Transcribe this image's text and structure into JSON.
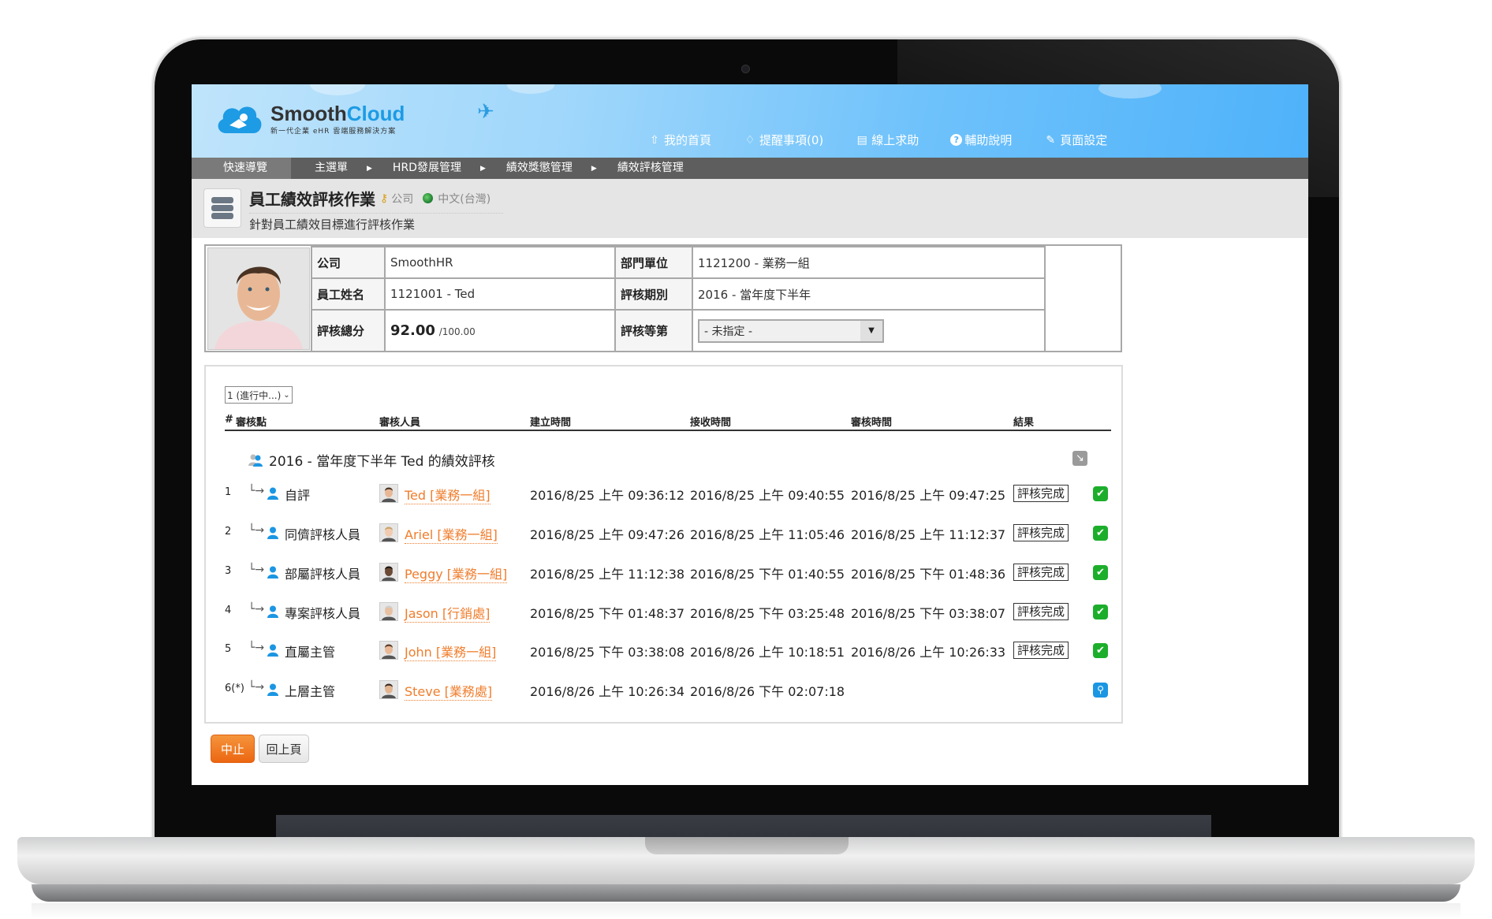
{
  "app": {
    "brand_part1": "Smooth",
    "brand_part2": "Cloud",
    "tagline": "新一代企業 eHR 雲端服務解決方案"
  },
  "top_links": [
    {
      "label": "我的首頁",
      "icon": "home-icon"
    },
    {
      "label": "提醒事項(0)",
      "icon": "bell-icon"
    },
    {
      "label": "線上求助",
      "icon": "help-chat-icon"
    },
    {
      "label": "輔助說明",
      "icon": "question-icon"
    },
    {
      "label": "頁面設定",
      "icon": "settings-icon"
    }
  ],
  "breadcrumb": {
    "quick_nav": "快速導覽",
    "items": [
      "主選單",
      "HRD發展管理",
      "績效獎懲管理",
      "績效評核管理"
    ]
  },
  "page": {
    "title": "員工績效評核作業",
    "scope": "公司",
    "language": "中文(台灣)",
    "subtitle": "針對員工績效目標進行評核作業"
  },
  "employee": {
    "company_label": "公司",
    "company": "SmoothHR",
    "dept_label": "部門單位",
    "dept": "1121200 - 業務一組",
    "name_label": "員工姓名",
    "name": "1121001 - Ted",
    "period_label": "評核期別",
    "period": "2016 - 當年度下半年",
    "score_label": "評核總分",
    "score": "92.00",
    "score_max": "/100.00",
    "grade_label": "評核等第",
    "grade_value": "- 未指定 -"
  },
  "flow": {
    "version_select": "1 (進行中...)",
    "columns": {
      "num": "#",
      "node": "審核點",
      "reviewer": "審核人員",
      "created": "建立時間",
      "received": "接收時間",
      "reviewed": "審核時間",
      "result": "結果"
    },
    "group_title": "2016 - 當年度下半年 Ted 的績效評核",
    "rows": [
      {
        "num": "1",
        "node": "自評",
        "reviewer": "Ted [業務一組]",
        "created": "2016/8/25 上午 09:36:12",
        "received": "2016/8/25 上午 09:40:55",
        "reviewed": "2016/8/25 上午 09:47:25",
        "status": "評核完成",
        "result": "done"
      },
      {
        "num": "2",
        "node": "同儕評核人員",
        "reviewer": "Ariel [業務一組]",
        "created": "2016/8/25 上午 09:47:26",
        "received": "2016/8/25 上午 11:05:46",
        "reviewed": "2016/8/25 上午 11:12:37",
        "status": "評核完成",
        "result": "done"
      },
      {
        "num": "3",
        "node": "部屬評核人員",
        "reviewer": "Peggy [業務一組]",
        "created": "2016/8/25 上午 11:12:38",
        "received": "2016/8/25 下午 01:40:55",
        "reviewed": "2016/8/25 下午 01:48:36",
        "status": "評核完成",
        "result": "done"
      },
      {
        "num": "4",
        "node": "專案評核人員",
        "reviewer": "Jason [行銷處]",
        "created": "2016/8/25 下午 01:48:37",
        "received": "2016/8/25 下午 03:25:48",
        "reviewed": "2016/8/25 下午 03:38:07",
        "status": "評核完成",
        "result": "done"
      },
      {
        "num": "5",
        "node": "直屬主管",
        "reviewer": "John [業務一組]",
        "created": "2016/8/25 下午 03:38:08",
        "received": "2016/8/26 上午 10:18:51",
        "reviewed": "2016/8/26 上午 10:26:33",
        "status": "評核完成",
        "result": "done"
      },
      {
        "num": "6(*)",
        "node": "上層主管",
        "reviewer": "Steve [業務處]",
        "created": "2016/8/26 上午 10:26:34",
        "received": "2016/8/26 下午 02:07:18",
        "reviewed": "",
        "status": "",
        "result": "pending"
      }
    ]
  },
  "buttons": {
    "stop": "中止",
    "back": "回上頁"
  },
  "colors": {
    "accent_orange": "#f07d2c",
    "header_blue": "#4fb2fa",
    "nav_gray": "#5e5e5e",
    "done_green": "#1cae2b",
    "view_blue": "#1b96e3"
  }
}
